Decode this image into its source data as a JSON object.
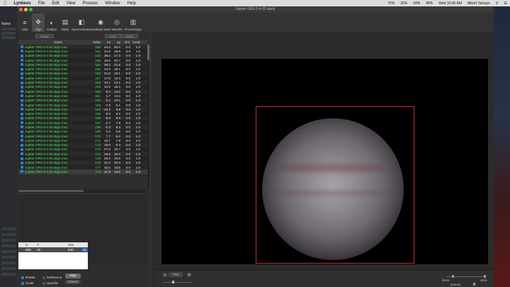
{
  "menubar": {
    "app": "Lynkeos",
    "items": [
      "File",
      "Edit",
      "View",
      "Process",
      "Window",
      "Help"
    ],
    "status": [
      "76%",
      "32%",
      "34%",
      "46%"
    ],
    "datetime": "Wed 10:06 AM",
    "user": "Albert Tamayo"
  },
  "desktop": {
    "label": "Name"
  },
  "window": {
    "title": "Jupiter GRS 5-4-20 stack"
  },
  "toolbar": {
    "items": [
      {
        "label": "Lists",
        "icon": "≡"
      },
      {
        "label": "Align",
        "icon": "✥"
      },
      {
        "label": "Analyze",
        "icon": "◐"
      },
      {
        "label": "Stack",
        "icon": "▤"
      },
      {
        "label": "Deconvolution",
        "icon": "◧"
      },
      {
        "label": "Unsharp mask",
        "icon": "◉"
      },
      {
        "label": "Wavelet",
        "icon": "◎"
      },
      {
        "label": "Processings",
        "icon": "▥"
      }
    ]
  },
  "segments": {
    "left": "Image",
    "right1": "Lists",
    "right2": "Block"
  },
  "table": {
    "headers": [
      "Name",
      "Index",
      "Δx",
      "Δy",
      "Rot.",
      "Scale"
    ],
    "rows": [
      {
        "name": "Jupiter GRS 5-4-20 align.mov",
        "index": "150",
        "dx": "44.4",
        "dy": "20.4",
        "rot": "0.0",
        "scale": "1.0"
      },
      {
        "name": "Jupiter GRS 5-4-20 align.mov",
        "index": "151",
        "dx": "41.6",
        "dy": "18.9",
        "rot": "0.0",
        "scale": "1.0"
      },
      {
        "name": "Jupiter GRS 5-4-20 align.mov",
        "index": "152",
        "dx": "36.2",
        "dy": "17.3",
        "rot": "0.0",
        "scale": "1.0"
      },
      {
        "name": "Jupiter GRS 5-4-20 align.mov",
        "index": "153",
        "dx": "34.9",
        "dy": "20.7",
        "rot": "0.0",
        "scale": "1.0"
      },
      {
        "name": "Jupiter GRS 5-4-20 align.mov",
        "index": "154",
        "dx": "28.2",
        "dy": "21.6",
        "rot": "0.0",
        "scale": "1.0"
      },
      {
        "name": "Jupiter GRS 5-4-20 align.mov",
        "index": "155",
        "dx": "24.0",
        "dy": "18.1",
        "rot": "0.0",
        "scale": "1.0"
      },
      {
        "name": "Jupiter GRS 5-4-20 align.mov",
        "index": "156",
        "dx": "21.0",
        "dy": "18.1",
        "rot": "0.0",
        "scale": "1.0"
      },
      {
        "name": "Jupiter GRS 5-4-20 align.mov",
        "index": "157",
        "dx": "17.8",
        "dy": "12.0",
        "rot": "0.0",
        "scale": "1.0"
      },
      {
        "name": "Jupiter GRS 5-4-20 align.mov",
        "index": "158",
        "dx": "10.1",
        "dy": "14.1",
        "rot": "0.0",
        "scale": "1.0"
      },
      {
        "name": "Jupiter GRS 5-4-20 align.mov",
        "index": "159",
        "dx": "10.0",
        "dy": "16.3",
        "rot": "0.0",
        "scale": "1.0"
      },
      {
        "name": "Jupiter GRS 5-4-20 align.mov",
        "index": "160",
        "dx": "8.2",
        "dy": "13.5",
        "rot": "0.0",
        "scale": "1.0"
      },
      {
        "name": "Jupiter GRS 5-4-20 align.mov",
        "index": "161",
        "dx": "2.7",
        "dy": "13.4",
        "rot": "0.0",
        "scale": "1.0"
      },
      {
        "name": "Jupiter GRS 5-4-20 align.mov",
        "index": "162",
        "dx": "-2.1",
        "dy": "13.1",
        "rot": "0.0",
        "scale": "1.0"
      },
      {
        "name": "Jupiter GRS 5-4-20 align.mov",
        "index": "163",
        "dx": "-7.8",
        "dy": "6.1",
        "rot": "0.0",
        "scale": "1.0"
      },
      {
        "name": "Jupiter GRS 5-4-20 align.mov",
        "index": "164",
        "dx": "-10.2",
        "dy": "8.8",
        "rot": "0.0",
        "scale": "1.0"
      },
      {
        "name": "Jupiter GRS 5-4-20 align.mov",
        "index": "165",
        "dx": "-8.3",
        "dy": "8.2",
        "rot": "0.0",
        "scale": "1.0"
      },
      {
        "name": "Jupiter GRS 5-4-20 align.mov",
        "index": "166",
        "dx": "-5.8",
        "dy": "6.0",
        "rot": "0.0",
        "scale": "1.0"
      },
      {
        "name": "Jupiter GRS 5-4-20 align.mov",
        "index": "167",
        "dx": "-2.7",
        "dy": "7.9",
        "rot": "0.0",
        "scale": "1.0"
      },
      {
        "name": "Jupiter GRS 5-4-20 align.mov",
        "index": "168",
        "dx": "-0.3",
        "dy": "8.3",
        "rot": "0.0",
        "scale": "1.0"
      },
      {
        "name": "Jupiter GRS 5-4-20 align.mov",
        "index": "169",
        "dx": "2.4",
        "dy": "6.8",
        "rot": "0.0",
        "scale": "1.0"
      },
      {
        "name": "Jupiter GRS 5-4-20 align.mov",
        "index": "170",
        "dx": "7.7",
        "dy": "6.2",
        "rot": "0.0",
        "scale": "1.0"
      },
      {
        "name": "Jupiter GRS 5-4-20 align.mov",
        "index": "171",
        "dx": "10.7",
        "dy": "7.9",
        "rot": "0.0",
        "scale": "1.0"
      },
      {
        "name": "Jupiter GRS 5-4-20 align.mov",
        "index": "172",
        "dx": "19.0",
        "dy": "6.4",
        "rot": "0.0",
        "scale": "1.0"
      },
      {
        "name": "Jupiter GRS 5-4-20 align.mov",
        "index": "173",
        "dx": "27.6",
        "dy": "10.7",
        "rot": "0.0",
        "scale": "1.0"
      },
      {
        "name": "Jupiter GRS 5-4-20 align.mov",
        "index": "174",
        "dx": "28.9",
        "dy": "15.0",
        "rot": "0.0",
        "scale": "1.0"
      },
      {
        "name": "Jupiter GRS 5-4-20 align.mov",
        "index": "175",
        "dx": "29.6",
        "dy": "16.8",
        "rot": "0.0",
        "scale": "1.0"
      },
      {
        "name": "Jupiter GRS 5-4-20 align.mov",
        "index": "176",
        "dx": "31.4",
        "dy": "20.0",
        "rot": "0.0",
        "scale": "1.0"
      },
      {
        "name": "Jupiter GRS 5-4-20 align.mov",
        "index": "177",
        "dx": "32.6",
        "dy": "18.5",
        "rot": "0.0",
        "scale": "1.0"
      },
      {
        "name": "Jupiter GRS 5-4-20 align.mov",
        "index": "178",
        "dx": "31.9",
        "dy": "16.8",
        "rot": "0.0",
        "scale": "1.0"
      }
    ]
  },
  "align_points": {
    "headers": [
      "X",
      "Y",
      "Size"
    ],
    "row": {
      "x": "536",
      "y": "22",
      "size": "640"
    }
  },
  "options": {
    "rotate": "Rotate",
    "reference": "Reference",
    "scale": "Scale",
    "specific": "Specific",
    "align_button": "Align",
    "cancel_button": "Cancel"
  },
  "zoom": {
    "value": "77%"
  },
  "levels": {
    "black": "black",
    "white": "white",
    "gamma": "gamma"
  },
  "colors": {
    "green_text": "#44ee55",
    "accent": "#2e7dd6",
    "roi": "#c0303a"
  }
}
